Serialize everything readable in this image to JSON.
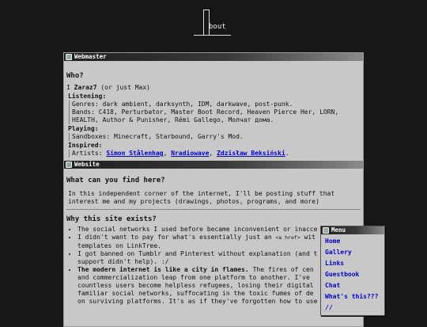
{
  "header": {
    "logo_text": "bout"
  },
  "webmaster": {
    "title": "Webmaster",
    "heading": "Who?",
    "intro": "I Zaraz7 (or just Max)",
    "listening_label": "Listening:",
    "genres": "Genres: dark ambient, darksynth, IDM, darkwave, post-punk.",
    "bands": "Bands: C418, Perturbator, Master Boot Record, Heaven Pierce Her, LORN,",
    "bands2": "HEALTH, Author & Punisher, Rémi Gallego, Молчат дома.",
    "playing_label": "Playing:",
    "sandboxes": "Sandboxes: Minecraft, Starbound, Garry's Mod.",
    "inspired_label": "Inspired:",
    "artists_prefix": "Artists:",
    "artists": [
      "Simon Stålenhag",
      "Nradiowave",
      "Zdzisław Beksiński"
    ]
  },
  "website": {
    "title": "Website",
    "heading": "What can you find here?",
    "text": "In this independent corner of the internet, I'll be posting stuff that",
    "text2": "interest me and my projects (drawings, photos, programs, and more)",
    "heading2": "Why this site exists?",
    "bullets": [
      "The social networks I used before became inconvenient or inacce",
      "I didn't want to pay for what's essentially just an",
      "templates on LinkTree.",
      "I got banned on Tumblr and Pinterest without explanation (and t",
      "support didn't help). :/",
      "The modern internet is like a city in flames.",
      "The fires of cen",
      "and commercialization leap from one platform to another. I've",
      "countless users become helpless refugees, losing their digital",
      "familiar social networks, suffocating in the toxic fumes of de",
      "on surviving platforms. It's as if they've forgotten how to use the Net,"
    ],
    "code_snip": "<a href>",
    "code_after": "wit"
  },
  "menu": {
    "title": "Menu",
    "items": [
      "Home",
      "Gallery",
      "Links",
      "Guestbook",
      "Chat",
      "What's this???",
      "//"
    ]
  }
}
